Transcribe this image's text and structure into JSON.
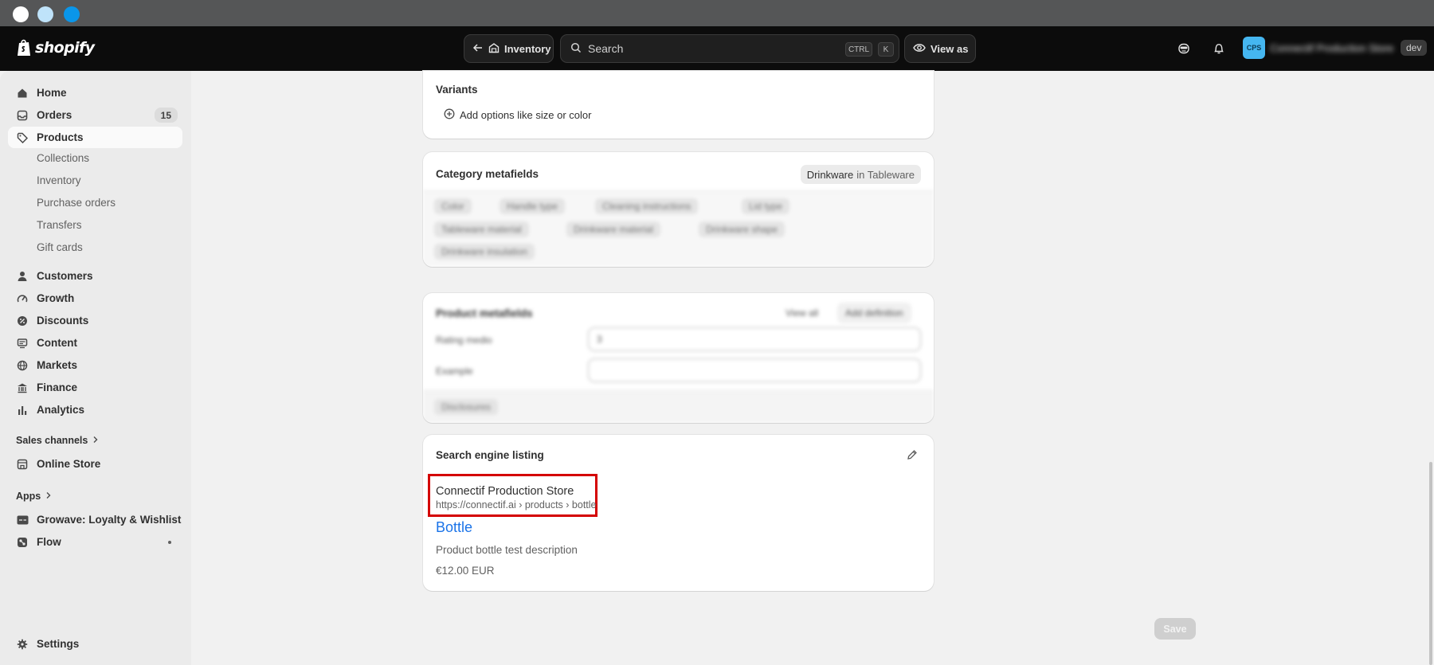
{
  "topbar": {
    "brand": "shopify",
    "back_label": "Inventory",
    "search_placeholder": "Search",
    "search_shortcut_1": "CTRL",
    "search_shortcut_2": "K",
    "view_as_label": "View as",
    "store_initials": "CPS",
    "store_name": "Connectif Production Store",
    "env_badge": "dev"
  },
  "sidebar": {
    "items": [
      {
        "label": "Home",
        "icon": "home-icon"
      },
      {
        "label": "Orders",
        "icon": "inbox-icon",
        "badge": "15"
      },
      {
        "label": "Products",
        "icon": "tag-icon",
        "active": true
      }
    ],
    "product_subitems": [
      "Collections",
      "Inventory",
      "Purchase orders",
      "Transfers",
      "Gift cards"
    ],
    "more_items": [
      {
        "label": "Customers",
        "icon": "person-icon"
      },
      {
        "label": "Growth",
        "icon": "gauge-icon"
      },
      {
        "label": "Discounts",
        "icon": "discount-icon"
      },
      {
        "label": "Content",
        "icon": "content-icon"
      },
      {
        "label": "Markets",
        "icon": "globe-icon"
      },
      {
        "label": "Finance",
        "icon": "bank-icon"
      },
      {
        "label": "Analytics",
        "icon": "bar-chart-icon"
      }
    ],
    "sales_channels_label": "Sales channels",
    "online_store_label": "Online Store",
    "apps_label": "Apps",
    "apps": [
      {
        "label": "Growave: Loyalty & Wishlist",
        "icon": "growave-icon"
      },
      {
        "label": "Flow",
        "icon": "flow-icon"
      }
    ],
    "settings_label": "Settings"
  },
  "variants": {
    "title": "Variants",
    "add_options_label": "Add options like size or color"
  },
  "category_metafields": {
    "title": "Category metafields",
    "category": "Drinkware",
    "category_in": "in Tableware",
    "chips": [
      "Color",
      "Handle type",
      "Cleaning instructions",
      "Lid type",
      "Tableware material",
      "Drinkware material",
      "Drinkware shape",
      "Drinkware insulation"
    ]
  },
  "product_metafields": {
    "title": "Product metafields",
    "view_all_label": "View all",
    "add_definition_label": "Add definition",
    "fields": [
      {
        "label": "Rating medio",
        "value": "3"
      },
      {
        "label": "Example",
        "value": ""
      }
    ],
    "footer_chip": "Disclosures"
  },
  "seo": {
    "title": "Search engine listing",
    "store_name": "Connectif Production Store",
    "url": "https://connectif.ai › products › bottle",
    "page_title": "Bottle",
    "description": "Product bottle test description",
    "price": "€12.00 EUR"
  },
  "footer": {
    "save_label": "Save"
  },
  "colors": {
    "link_blue": "#1a73e8",
    "highlight_red": "#d40000",
    "avatar_blue": "#45b6f0"
  }
}
